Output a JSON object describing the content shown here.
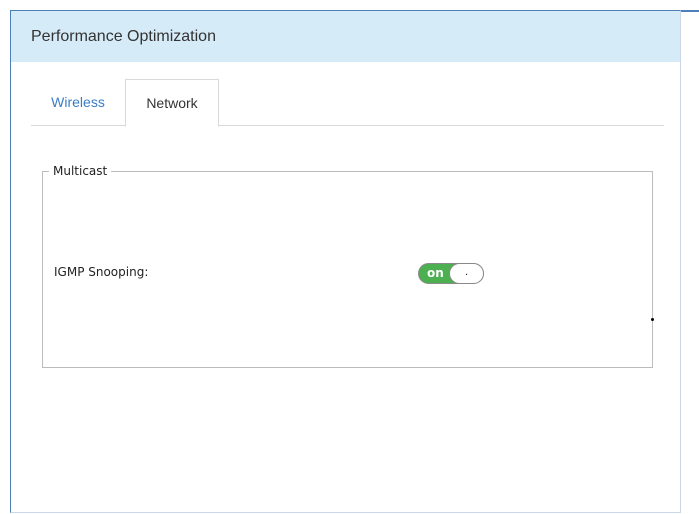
{
  "panel": {
    "title": "Performance Optimization"
  },
  "tabs": [
    {
      "label": "Wireless",
      "active": false
    },
    {
      "label": "Network",
      "active": true
    }
  ],
  "multicast": {
    "legend": "Multicast",
    "igmp_snooping": {
      "label": "IGMP Snooping:",
      "state_label": "on",
      "enabled": true,
      "knob_text": "."
    }
  },
  "colors": {
    "header_bg": "#d6ebf8",
    "accent_border": "#4d7fb8",
    "inactive_tab_text": "#3a7cc4",
    "toggle_on": "#4caf50"
  },
  "icons": {
    "toggle_knob": "toggle-knob-icon"
  }
}
